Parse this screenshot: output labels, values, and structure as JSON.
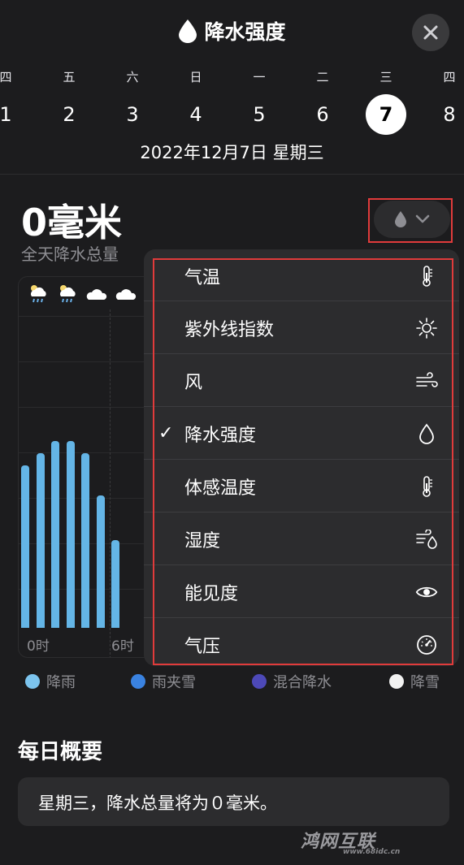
{
  "header": {
    "title": "降水强度",
    "title_icon": "drop-icon",
    "close_icon": "close-icon"
  },
  "calendar": {
    "weekdays": [
      "四",
      "五",
      "六",
      "日",
      "一",
      "二",
      "三",
      "四"
    ],
    "days": [
      "1",
      "2",
      "3",
      "4",
      "5",
      "6",
      "7",
      "8"
    ],
    "selected_index": 6,
    "date_text": "2022年12月7日 星期三"
  },
  "total": {
    "value": "0毫米",
    "subtitle": "全天降水总量"
  },
  "metric_selector": {
    "icon": "drop-icon",
    "chevron": "chevron-down-icon"
  },
  "menu": {
    "items": [
      {
        "label": "气温",
        "icon": "thermometer-icon",
        "checked": false
      },
      {
        "label": "紫外线指数",
        "icon": "sun-icon",
        "checked": false
      },
      {
        "label": "风",
        "icon": "wind-icon",
        "checked": false
      },
      {
        "label": "降水强度",
        "icon": "drop-icon",
        "checked": true
      },
      {
        "label": "体感温度",
        "icon": "thermometer-icon",
        "checked": false
      },
      {
        "label": "湿度",
        "icon": "humidity-icon",
        "checked": false
      },
      {
        "label": "能见度",
        "icon": "eye-icon",
        "checked": false
      },
      {
        "label": "气压",
        "icon": "gauge-icon",
        "checked": false
      }
    ],
    "check_mark": "✓"
  },
  "chart_data": {
    "type": "bar",
    "x_ticks": [
      "0时",
      "6时"
    ],
    "values": [
      0.8,
      0.86,
      0.92,
      0.92,
      0.86,
      0.65,
      0.43
    ],
    "ylim": [
      0,
      1
    ],
    "weather_icons": [
      "rain-cloud-icon",
      "rain-cloud-icon",
      "cloud-icon",
      "cloud-icon"
    ]
  },
  "legend": [
    {
      "label": "降雨",
      "color": "#7cc4ee"
    },
    {
      "label": "雨夹雪",
      "color": "#3a82e0"
    },
    {
      "label": "混合降水",
      "color": "#4d49b8"
    },
    {
      "label": "降雪",
      "color": "#f2f2f2"
    }
  ],
  "summary": {
    "title": "每日概要",
    "text": "星期三，降水总量将为０毫米。"
  },
  "watermark": {
    "text": "鸿网互联",
    "url": "www.68idc.cn"
  }
}
